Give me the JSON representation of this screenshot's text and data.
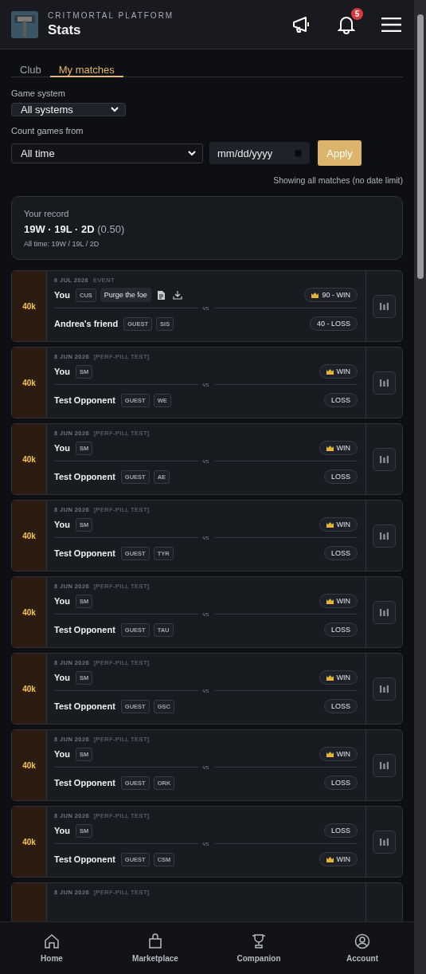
{
  "header": {
    "eyebrow": "CRITMORTAL PLATFORM",
    "title": "Stats",
    "notifications": "5"
  },
  "tabs": [
    {
      "label": "Club",
      "selected": false
    },
    {
      "label": "My matches",
      "selected": true
    }
  ],
  "filters": {
    "system_label": "Game system",
    "system_value": "All systems",
    "from_label": "Count games from",
    "from_value": "All time",
    "date_placeholder": "mm/dd/yyyy",
    "apply": "Apply",
    "note": "Showing all matches (no date limit)"
  },
  "record": {
    "label": "Your record",
    "summary": "19W · 19L · 2D",
    "ratio": "(0.50)",
    "all_time": "All time: 19W / 19L / 2D"
  },
  "matches": [
    {
      "system": "40k",
      "date": "6 JUL 2026",
      "event": "EVENT",
      "files": true,
      "versus": "vs",
      "players": [
        {
          "name": "You",
          "tags": [
            {
              "label": "CUS",
              "kind": "faction"
            },
            {
              "label": "Purge the foe",
              "kind": "mission"
            }
          ],
          "result": "90 - WIN",
          "winner": true
        },
        {
          "name": "Andrea's friend",
          "tags": [
            {
              "label": "GUEST",
              "kind": "faction"
            },
            {
              "label": "SIS",
              "kind": "faction"
            }
          ],
          "result": "40 - LOSS",
          "winner": false
        }
      ]
    },
    {
      "system": "40k",
      "date": "8 JUN 2026",
      "event": "[PERF-PILL TEST]",
      "files": false,
      "versus": "vs",
      "players": [
        {
          "name": "You",
          "tags": [
            {
              "label": "SM",
              "kind": "faction"
            }
          ],
          "result": "WIN",
          "winner": true
        },
        {
          "name": "Test Opponent",
          "tags": [
            {
              "label": "GUEST",
              "kind": "faction"
            },
            {
              "label": "WE",
              "kind": "faction"
            }
          ],
          "result": "LOSS",
          "winner": false
        }
      ]
    },
    {
      "system": "40k",
      "date": "8 JUN 2026",
      "event": "[PERF-PILL TEST]",
      "files": false,
      "versus": "vs",
      "players": [
        {
          "name": "You",
          "tags": [
            {
              "label": "SM",
              "kind": "faction"
            }
          ],
          "result": "WIN",
          "winner": true
        },
        {
          "name": "Test Opponent",
          "tags": [
            {
              "label": "GUEST",
              "kind": "faction"
            },
            {
              "label": "AE",
              "kind": "faction"
            }
          ],
          "result": "LOSS",
          "winner": false
        }
      ]
    },
    {
      "system": "40k",
      "date": "8 JUN 2026",
      "event": "[PERF-PILL TEST]",
      "files": false,
      "versus": "vs",
      "players": [
        {
          "name": "You",
          "tags": [
            {
              "label": "SM",
              "kind": "faction"
            }
          ],
          "result": "WIN",
          "winner": true
        },
        {
          "name": "Test Opponent",
          "tags": [
            {
              "label": "GUEST",
              "kind": "faction"
            },
            {
              "label": "TYR",
              "kind": "faction"
            }
          ],
          "result": "LOSS",
          "winner": false
        }
      ]
    },
    {
      "system": "40k",
      "date": "8 JUN 2026",
      "event": "[PERF-PILL TEST]",
      "files": false,
      "versus": "vs",
      "players": [
        {
          "name": "You",
          "tags": [
            {
              "label": "SM",
              "kind": "faction"
            }
          ],
          "result": "WIN",
          "winner": true
        },
        {
          "name": "Test Opponent",
          "tags": [
            {
              "label": "GUEST",
              "kind": "faction"
            },
            {
              "label": "TAU",
              "kind": "faction"
            }
          ],
          "result": "LOSS",
          "winner": false
        }
      ]
    },
    {
      "system": "40k",
      "date": "8 JUN 2026",
      "event": "[PERF-PILL TEST]",
      "files": false,
      "versus": "vs",
      "players": [
        {
          "name": "You",
          "tags": [
            {
              "label": "SM",
              "kind": "faction"
            }
          ],
          "result": "WIN",
          "winner": true
        },
        {
          "name": "Test Opponent",
          "tags": [
            {
              "label": "GUEST",
              "kind": "faction"
            },
            {
              "label": "GSC",
              "kind": "faction"
            }
          ],
          "result": "LOSS",
          "winner": false
        }
      ]
    },
    {
      "system": "40k",
      "date": "8 JUN 2026",
      "event": "[PERF-PILL TEST]",
      "files": false,
      "versus": "vs",
      "players": [
        {
          "name": "You",
          "tags": [
            {
              "label": "SM",
              "kind": "faction"
            }
          ],
          "result": "WIN",
          "winner": true
        },
        {
          "name": "Test Opponent",
          "tags": [
            {
              "label": "GUEST",
              "kind": "faction"
            },
            {
              "label": "ORK",
              "kind": "faction"
            }
          ],
          "result": "LOSS",
          "winner": false
        }
      ]
    },
    {
      "system": "40k",
      "date": "8 JUN 2026",
      "event": "[PERF-PILL TEST]",
      "files": false,
      "versus": "vs",
      "players": [
        {
          "name": "You",
          "tags": [
            {
              "label": "SM",
              "kind": "faction"
            }
          ],
          "result": "LOSS",
          "winner": false
        },
        {
          "name": "Test Opponent",
          "tags": [
            {
              "label": "GUEST",
              "kind": "faction"
            },
            {
              "label": "CSM",
              "kind": "faction"
            }
          ],
          "result": "WIN",
          "winner": true
        }
      ]
    },
    {
      "date": "8 JUN 2026",
      "event": "[PERF-PILL TEST]"
    }
  ],
  "nav": [
    {
      "label": "Home",
      "kind": "home"
    },
    {
      "label": "Marketplace",
      "kind": "market"
    },
    {
      "label": "Companion",
      "kind": "trophy"
    },
    {
      "label": "Account",
      "kind": "account"
    }
  ]
}
